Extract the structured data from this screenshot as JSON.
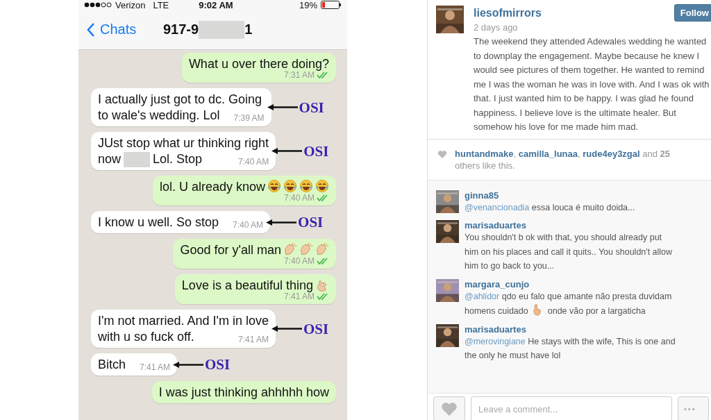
{
  "phone": {
    "status_bar": {
      "carrier": "Verizon",
      "network": "LTE",
      "time": "9:02 AM",
      "battery": "19%"
    },
    "nav": {
      "back": "Chats",
      "title_start": "917-9",
      "title_end": "1"
    },
    "messages": [
      {
        "kind": "sent",
        "lines": [
          [
            "What u over there doing?"
          ]
        ],
        "time": "7:31 AM",
        "read": true
      },
      {
        "kind": "received",
        "lines": [
          [
            "I actually just got to dc. Going"
          ],
          [
            "to wale's wedding. Lol"
          ]
        ],
        "time": "7:39 AM",
        "annotation": "OSI"
      },
      {
        "kind": "received",
        "lines": [
          [
            "JUst stop what ur thinking right"
          ],
          [
            "now",
            "Lol. Stop"
          ]
        ],
        "time": "7:40 AM",
        "annotation": "OSI"
      },
      {
        "kind": "sent",
        "lines": [
          [
            "lol. U already know"
          ]
        ],
        "emojis": [
          {
            "kind": "tears-of-joy"
          },
          {
            "kind": "tears-of-joy"
          },
          {
            "kind": "tears-of-joy"
          },
          {
            "kind": "tears-of-joy"
          }
        ],
        "time": "7:40 AM",
        "read": true
      },
      {
        "kind": "received",
        "lines": [
          [
            "I know u well. So stop"
          ]
        ],
        "time": "7:40 AM",
        "annotation": "OSI"
      },
      {
        "kind": "sent",
        "lines": [
          [
            "Good for y'all man"
          ]
        ],
        "emojis": [
          {
            "kind": "clap"
          },
          {
            "kind": "clap"
          },
          {
            "kind": "clap"
          }
        ],
        "time": "7:40 AM",
        "read": true
      },
      {
        "kind": "sent",
        "lines": [
          [
            "Love is a beautiful thing"
          ]
        ],
        "emojis": [
          {
            "kind": "ok-hand"
          }
        ],
        "time": "7:41 AM",
        "read": true
      },
      {
        "kind": "received",
        "lines": [
          [
            "I'm not married. And I'm in love"
          ],
          [
            "with u so fuck off."
          ]
        ],
        "time": "7:41 AM",
        "annotation": "OSI"
      },
      {
        "kind": "received",
        "lines": [
          [
            "Bitch"
          ]
        ],
        "time": "7:41 AM",
        "annotation": "OSI"
      },
      {
        "kind": "sent",
        "lines": [
          [
            "I was just thinking ahhhhh how"
          ]
        ]
      }
    ]
  },
  "post": {
    "username": "liesofmirrors",
    "time": "2 days ago",
    "follow": "Follow",
    "caption": "The weekend they attended Adewales wedding he wanted to downplay the engagement. Maybe because he knew I would see pictures of them together. He wanted to remind me I was the woman he was in love with. And I was ok with that. I just wanted him to be happy. I was glad he found happiness. I believe love is the ultimate healer. But somehow his love for me made him mad.",
    "likes": [
      [
        {
          "kind": "user",
          "text": "huntandmake"
        },
        {
          "kind": "text",
          "text": ", "
        },
        {
          "kind": "user",
          "text": "camilla_lunaa"
        },
        {
          "kind": "text",
          "text": ", "
        },
        {
          "kind": "user",
          "text": "rude4ey3zgal"
        },
        {
          "kind": "text",
          "text": " and "
        },
        {
          "kind": "count",
          "text": "25"
        }
      ],
      [
        {
          "kind": "text",
          "text": "others like this."
        }
      ]
    ],
    "comments": [
      {
        "username": "ginna85",
        "lines": [
          [
            {
              "kind": "mention",
              "text": "@venancionadia"
            },
            {
              "kind": "text",
              "text": " essa louca é muito doida..."
            }
          ]
        ]
      },
      {
        "username": "marisaduartes",
        "lines": [
          [
            {
              "kind": "text",
              "text": "You shouldn't b ok with that, you should already put"
            }
          ],
          [
            {
              "kind": "text",
              "text": "him on his places and call it quits.. You shouldn't allow"
            }
          ],
          [
            {
              "kind": "text",
              "text": "him to go back to you..."
            }
          ]
        ]
      },
      {
        "username": "margara_cunjo",
        "lines": [
          [
            {
              "kind": "mention",
              "text": "@ahlidor"
            },
            {
              "kind": "text",
              "text": " qdo eu falo que amante não presta duvidam"
            }
          ],
          [
            {
              "kind": "text",
              "text": "homens cuidado"
            },
            {
              "kind": "emoji"
            },
            {
              "kind": "text",
              "text": "onde vão por a largaticha"
            }
          ]
        ]
      },
      {
        "username": "marisaduartes",
        "lines": [
          [
            {
              "kind": "mention",
              "text": "@merovingiane"
            },
            {
              "kind": "text",
              "text": " He stays with the wife, This is one and"
            }
          ],
          [
            {
              "kind": "text",
              "text": "the only he must have lol"
            }
          ]
        ]
      }
    ],
    "comment_field": {
      "placeholder": "Leave a comment..."
    },
    "more": "•••"
  }
}
